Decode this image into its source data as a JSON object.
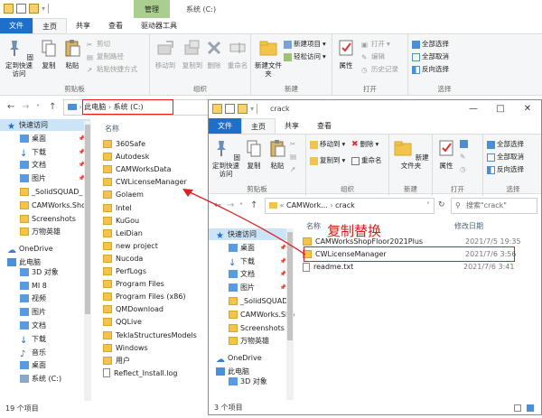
{
  "back": {
    "manage_tab": "管理",
    "title": "系统 (C:)",
    "tabs": {
      "file": "文件",
      "home": "主页",
      "share": "共享",
      "view": "查看",
      "drive_tools": "驱动器工具"
    },
    "ribbon": {
      "pin": "固定到快速访问",
      "copy": "复制",
      "paste": "粘贴",
      "cut": "剪切",
      "copy_path": "复制路径",
      "paste_shortcut": "粘贴快捷方式",
      "clipboard": "剪贴板",
      "move_to": "移动到",
      "copy_to": "复制到",
      "delete": "删除",
      "rename": "重命名",
      "organize": "组织",
      "new_folder": "新建文件夹",
      "new_item": "新建项目",
      "easy_access": "轻松访问",
      "new": "新建",
      "properties": "属性",
      "open": "打开",
      "edit": "编辑",
      "history": "历史记录",
      "open_group": "打开",
      "select_all": "全部选择",
      "select_none": "全部取消",
      "invert": "反向选择",
      "select": "选择"
    },
    "address": {
      "pc": "此电脑",
      "drive": "系统 (C:)"
    },
    "col_name": "名称",
    "nav": [
      "快速访问",
      "桌面",
      "下载",
      "文档",
      "图片",
      "_SolidSQUAD_",
      "CAMWorks.Sho",
      "Screenshots",
      "万物英雄",
      "OneDrive",
      "此电脑",
      "3D 对象",
      "MI 8",
      "视频",
      "图片",
      "文档",
      "下载",
      "音乐",
      "桌面",
      "系统 (C:)"
    ],
    "files": [
      "360Safe",
      "Autodesk",
      "CAMWorksData",
      "CWLicenseManager",
      "Golaem",
      "Intel",
      "KuGou",
      "LeiDian",
      "new project",
      "Nucoda",
      "PerfLogs",
      "Program Files",
      "Program Files (x86)",
      "QMDownload",
      "QQLive",
      "TeklaStructuresModels",
      "Windows",
      "用户",
      "Reflect_Install.log"
    ],
    "status": "19 个项目"
  },
  "front": {
    "title": "crack",
    "tabs": {
      "file": "文件",
      "home": "主页",
      "share": "共享",
      "view": "查看"
    },
    "ribbon": {
      "pin": "固定到快速访问",
      "copy": "复制",
      "paste": "粘贴",
      "clipboard": "剪贴板",
      "move_to": "移动到",
      "copy_to": "复制到",
      "delete": "删除",
      "rename": "重命名",
      "organize": "组织",
      "new_folder": "新建文件夹",
      "new": "新建",
      "properties": "属性",
      "open": "打开",
      "select_all": "全部选择",
      "select_none": "全部取消",
      "invert": "反向选择",
      "select": "选择"
    },
    "address": {
      "prefix": "«",
      "parent": "CAMWork...",
      "current": "crack"
    },
    "search_placeholder": "搜索\"crack\"",
    "col_name": "名称",
    "col_date": "修改日期",
    "nav": [
      "快速访问",
      "桌面",
      "下载",
      "文档",
      "图片",
      "_SolidSQUAD_",
      "CAMWorks.Sho",
      "Screenshots",
      "万物英雄",
      "OneDrive",
      "此电脑",
      "3D 对象"
    ],
    "files": [
      {
        "name": "CAMWorksShopFloor2021Plus",
        "date": "2021/7/5 19:35"
      },
      {
        "name": "CWLicenseManager",
        "date": "2021/7/6 3:56"
      },
      {
        "name": "readme.txt",
        "date": "2021/7/6 3:41"
      }
    ],
    "status": "3 个项目"
  },
  "annotation": "复制替换",
  "colors": {
    "accent": "#1e6fc9",
    "manage": "#a9cf8e",
    "folder": "#f2c54a",
    "annotation": "#e02020"
  }
}
